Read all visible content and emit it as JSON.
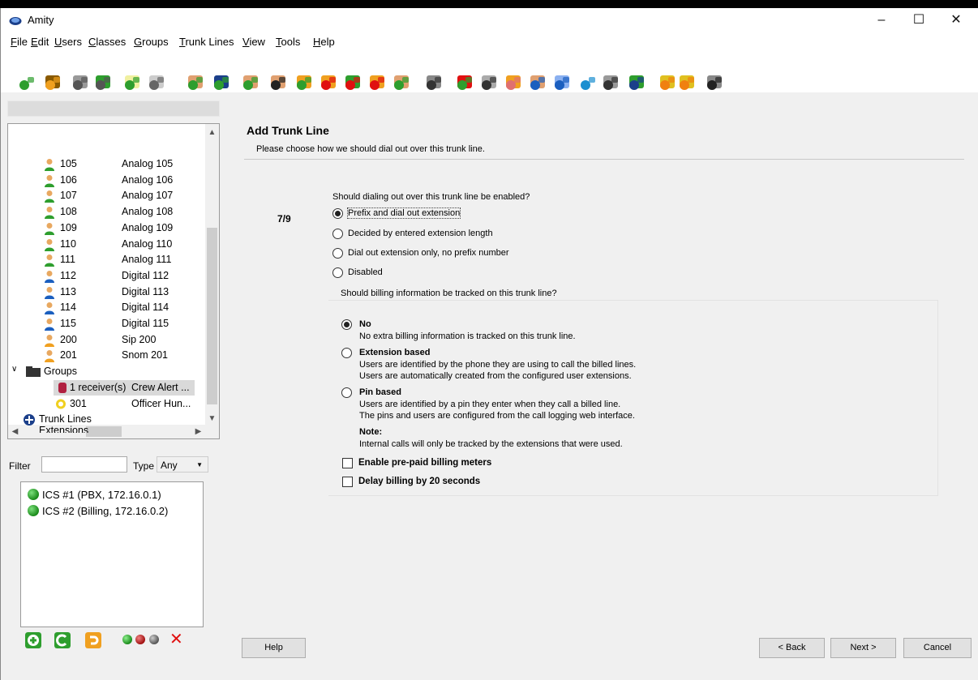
{
  "window": {
    "title": "Amity",
    "min": "–",
    "max": "☐",
    "close": "✕"
  },
  "menu": [
    "File",
    "Edit",
    "Users",
    "Classes",
    "Groups",
    "Trunk Lines",
    "View",
    "Tools",
    "Help"
  ],
  "toolbar_icons": [
    "new-icon",
    "open-folder-icon",
    "save-icon",
    "save-as-icon",
    "export-icon",
    "print-icon",
    "add-user-icon",
    "user-card-icon",
    "add-group-icon",
    "handset-icon",
    "handset-add-icon",
    "speaker-icon",
    "speaker-add-icon",
    "alert-add-icon",
    "group-users-icon",
    "fax-machine-icon",
    "add-extension-icon",
    "gear-icon",
    "gear-user-icon",
    "user-call-icon",
    "toggle-icon",
    "upload-icon",
    "settings-tools-icon",
    "trunk-add-icon",
    "back-arrow-icon",
    "forward-arrow-icon",
    "rack-icon"
  ],
  "tree": {
    "users": [
      {
        "num": "105",
        "desc": "Analog 105"
      },
      {
        "num": "106",
        "desc": "Analog 106"
      },
      {
        "num": "107",
        "desc": "Analog 107"
      },
      {
        "num": "108",
        "desc": "Analog 108"
      },
      {
        "num": "109",
        "desc": "Analog 109"
      },
      {
        "num": "110",
        "desc": "Analog 110"
      },
      {
        "num": "111",
        "desc": "Analog 111"
      },
      {
        "num": "112",
        "desc": "Digital 112"
      },
      {
        "num": "113",
        "desc": "Digital 113"
      },
      {
        "num": "114",
        "desc": "Digital 114"
      },
      {
        "num": "115",
        "desc": "Digital 115"
      },
      {
        "num": "200",
        "desc": "Sip 200"
      },
      {
        "num": "201",
        "desc": "Snom 201"
      }
    ],
    "groups_label": "Groups",
    "group_alert": {
      "num": "1 receiver(s)",
      "desc": "Crew Alert ..."
    },
    "group_hunt": {
      "num": "301",
      "desc": "Officer Hun..."
    },
    "trunk_lines": "Trunk Lines",
    "extensions": "Extensions"
  },
  "filter": {
    "label": "Filter",
    "value": "",
    "type_label": "Type",
    "type_value": "Any"
  },
  "servers": [
    "ICS #1 (PBX, 172.16.0.1)",
    "ICS #2 (Billing, 172.16.0.2)"
  ],
  "wizard": {
    "title": "Add Trunk Line",
    "subtitle": "Please choose how we should dial out over this trunk line.",
    "step": "7/9",
    "dial_question": "Should dialing out over this trunk line be enabled?",
    "dial_options": [
      {
        "label": "Prefix and dial out extension",
        "selected": true
      },
      {
        "label": "Decided by entered extension length",
        "selected": false
      },
      {
        "label": "Dial out extension only, no prefix number",
        "selected": false
      },
      {
        "label": "Disabled",
        "selected": false
      }
    ],
    "billing_question": "Should billing information be tracked on this trunk line?",
    "billing_options": [
      {
        "title": "No",
        "desc": [
          "No extra billing information is tracked on this trunk line."
        ],
        "selected": true
      },
      {
        "title": "Extension based",
        "desc": [
          "Users are identified by the phone they are using to call the billed lines.",
          "Users are automatically created from the configured user extensions."
        ],
        "selected": false
      },
      {
        "title": "Pin based",
        "desc": [
          "Users are identified by a pin they enter when they call a billed line.",
          "The pins and users are configured from the call logging web interface."
        ],
        "selected": false
      }
    ],
    "note_title": "Note:",
    "note_text": "Internal calls will only be tracked by the extensions that were used.",
    "checks": [
      {
        "label": "Enable pre-paid billing meters",
        "checked": false
      },
      {
        "label": "Delay billing by 20 seconds",
        "checked": false
      }
    ]
  },
  "buttons": {
    "help": "Help",
    "back": "< Back",
    "next": "Next >",
    "cancel": "Cancel"
  },
  "colors": {
    "green": "#2e9e2e",
    "red": "#e01010",
    "window_bg": "#f0f0f0"
  }
}
